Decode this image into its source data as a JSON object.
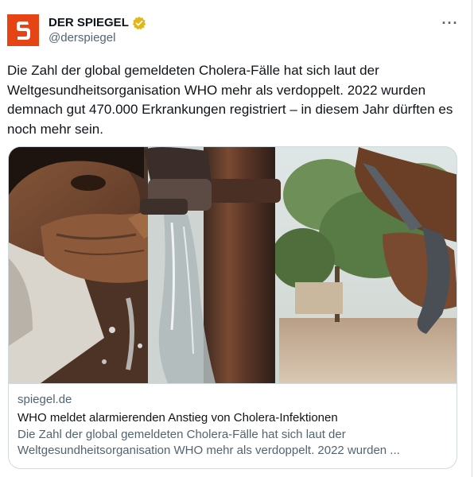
{
  "author": {
    "name": "DER SPIEGEL",
    "handle": "@derspiegel",
    "avatar_letter": "S",
    "avatar_color": "#e64415",
    "verified_color": "#e2b719",
    "verified_icon": "gold-verified-badge-icon"
  },
  "tweet": {
    "text": "Die Zahl der global gemeldeten Cholera-Fälle hat sich laut der Weltgesundheitsorganisation WHO mehr als verdoppelt. 2022 wurden demnach gut 470.000 Erkrankungen registriert – in diesem Jahr dürften es noch mehr sein."
  },
  "card": {
    "domain": "spiegel.de",
    "title": "WHO meldet alarmierenden Anstieg von Cholera-Infektionen",
    "description": "Die Zahl der global gemeldeten Cholera-Fälle hat sich laut der Weltgesundheitsorganisation WHO mehr als verdoppelt. 2022 wurden ..."
  },
  "icons": {
    "more": "more-options-icon"
  }
}
